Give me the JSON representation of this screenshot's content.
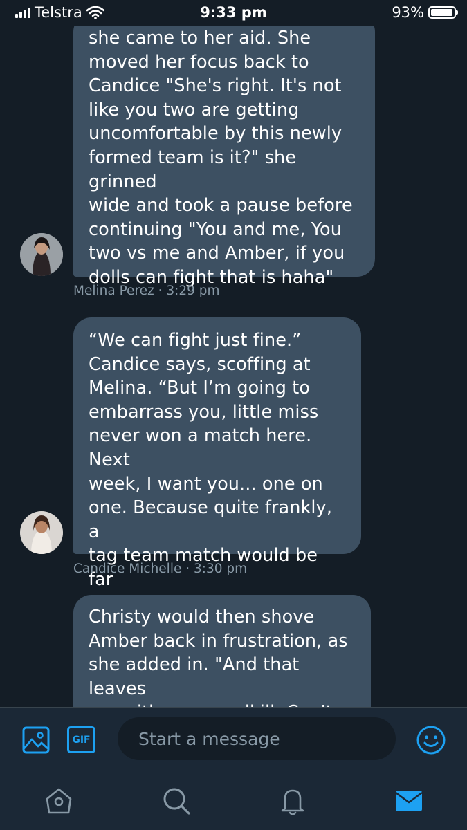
{
  "status_bar": {
    "carrier": "Telstra",
    "time": "9:33 pm",
    "battery": "93%",
    "battery_level": 0.93
  },
  "messages": [
    {
      "text": "she came to her aid. She\nmoved her focus back to\nCandice \"She's right. It's not\nlike you two are getting\nuncomfortable by this newly\nformed team is it?\" she grinned\nwide and took a pause before\ncontinuing \"You and me, You\ntwo vs me and Amber, if you\ndolls can fight that is haha\"",
      "sender": "Melina Perez",
      "time": "3:29 pm",
      "meta": "Melina Perez · 3:29 pm"
    },
    {
      "text": "“We can fight just fine.”\nCandice says, scoffing at\nMelina. “But I’m  going to\nembarrass you, little miss\nnever won a match here. Next\nweek, I  want you... one on\none. Because quite frankly, a\ntag team match would  be far\ntoo easy.”",
      "sender": "Candice Michelle",
      "time": "3:30 pm",
      "meta": "Candice Michelle · 3:30 pm"
    },
    {
      "text": "Christy would then shove\nAmber back in frustration, as\nshe added in.  \"And that leaves\nme with you, roadkill.  Can't\nwait to watch you go down.\"",
      "sender": "",
      "time": "",
      "meta": ""
    }
  ],
  "composer": {
    "placeholder": "Start a message",
    "gif_label": "GIF",
    "icons": [
      "image-icon",
      "gif-icon",
      "emoji-icon"
    ]
  },
  "tabs": [
    {
      "name": "home",
      "icon": "home-icon",
      "active": false
    },
    {
      "name": "search",
      "icon": "search-icon",
      "active": false
    },
    {
      "name": "notifications",
      "icon": "bell-icon",
      "active": false
    },
    {
      "name": "messages",
      "icon": "mail-icon",
      "active": true
    }
  ],
  "colors": {
    "background": "#141d26",
    "bubble": "#3d5062",
    "accent": "#1da1f2",
    "meta_text": "#8899a6"
  }
}
